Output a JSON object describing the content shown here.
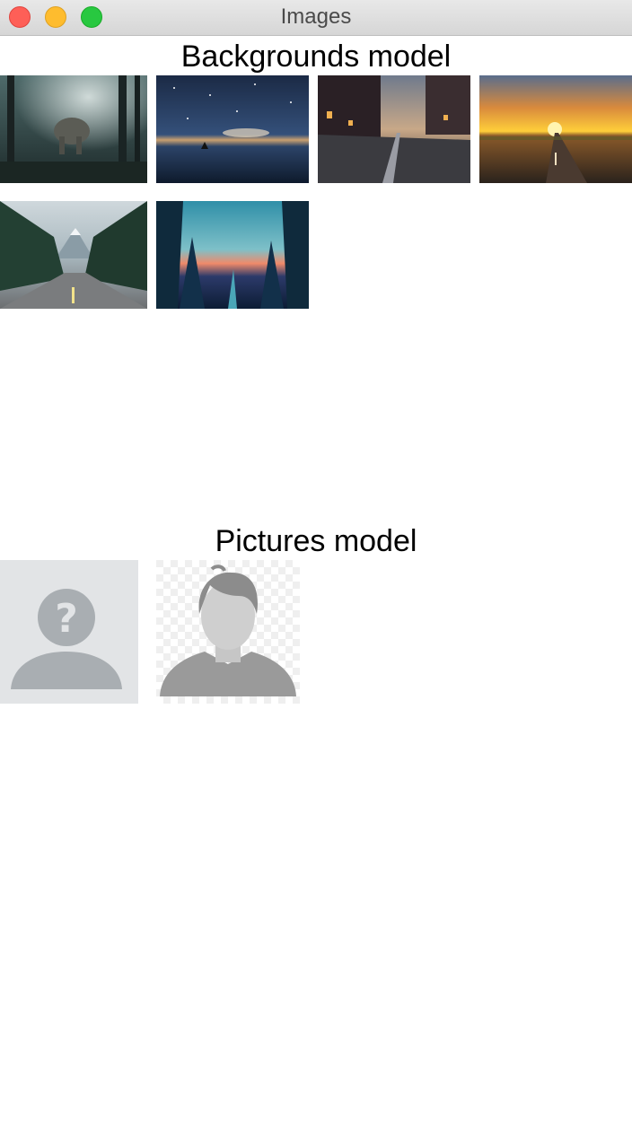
{
  "window": {
    "title": "Images"
  },
  "backgrounds": {
    "title": "Backgrounds model",
    "images": [
      {
        "subject": "elephant in a sunlit forest"
      },
      {
        "subject": "boat on a starry lake"
      },
      {
        "subject": "cobblestone street at dusk"
      },
      {
        "subject": "sunset over a straight road"
      },
      {
        "subject": "forest road with mountain"
      },
      {
        "subject": "illustrated forest at sunset"
      }
    ]
  },
  "pictures": {
    "title": "Pictures model",
    "images": [
      {
        "subject": "unknown user placeholder avatar"
      },
      {
        "subject": "male silhouette avatar"
      }
    ]
  },
  "colors": {
    "close": "#fe5f57",
    "minimize": "#febc2e",
    "maximize": "#28c840"
  }
}
